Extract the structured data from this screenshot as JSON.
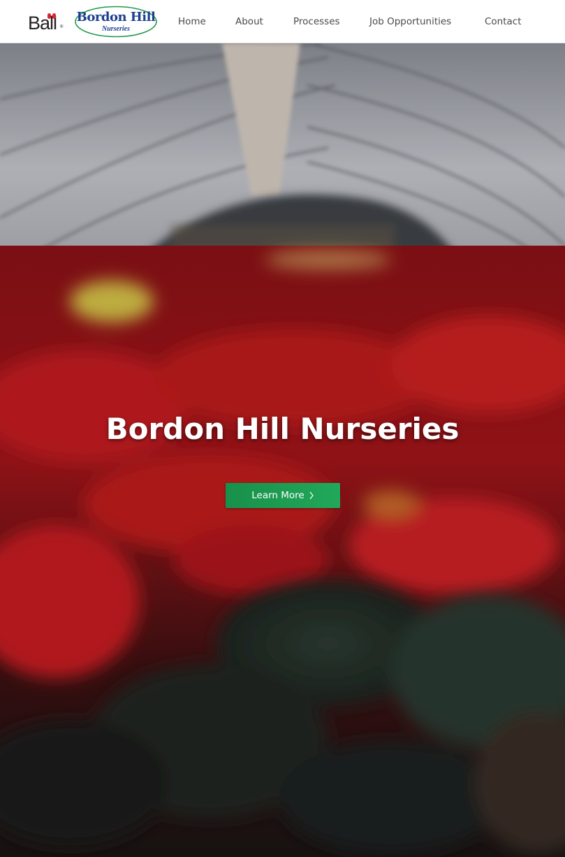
{
  "header": {
    "ball_logo": {
      "text": "Ba",
      "letters_end": "ll",
      "registered": "®"
    },
    "brand_logo": {
      "title": "Bordon Hill",
      "subtitle": "Nurseries"
    },
    "nav": [
      {
        "label": "Home"
      },
      {
        "label": "About"
      },
      {
        "label": "Processes"
      },
      {
        "label": "Job Opportunities"
      },
      {
        "label": "Contact"
      }
    ]
  },
  "hero": {
    "title": "Bordon Hill Nurseries",
    "cta_label": "Learn More",
    "cta_icon": "chevron-right-icon",
    "background_image": "greenhouse-poinsettias"
  },
  "colors": {
    "brand_blue": "#1b3f8f",
    "ball_red": "#d9262e",
    "cta_green": "#1f9d52",
    "nav_text": "#4a4a4a"
  }
}
